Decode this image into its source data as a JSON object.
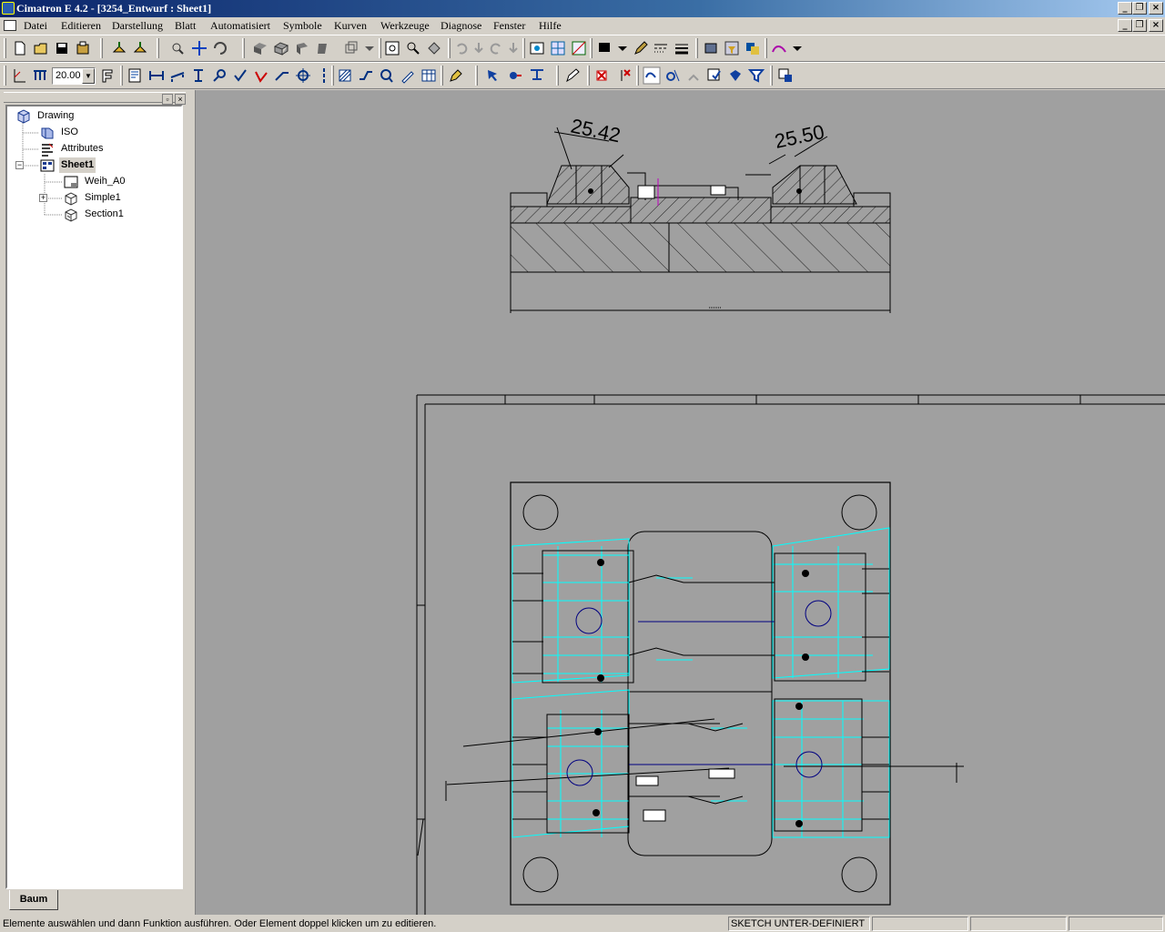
{
  "window": {
    "title": "Cimatron E 4.2 - [3254_Entwurf : Sheet1]",
    "minimize_glyph": "_",
    "restore_glyph": "❐",
    "close_glyph": "×"
  },
  "menu": {
    "items": [
      "Datei",
      "Editieren",
      "Darstellung",
      "Blatt",
      "Automatisiert",
      "Symbole",
      "Kurven",
      "Werkzeuge",
      "Diagnose",
      "Fenster",
      "Hilfe"
    ]
  },
  "toolbar2": {
    "scale_value": "20.00"
  },
  "tree": {
    "root": "Drawing",
    "iso": "ISO",
    "attributes": "Attributes",
    "sheet": "Sheet1",
    "weih": "Weih_A0",
    "simple": "Simple1",
    "section": "Section1"
  },
  "tabs": {
    "baum": "Baum"
  },
  "drawing": {
    "dim_left": "25.42",
    "dim_right": "25.50"
  },
  "status": {
    "message": "Elemente auswählen und dann Funktion ausführen. Oder Element doppel klicken um zu editieren.",
    "sketch": "SKETCH UNTER-DEFINIERT"
  },
  "colors": {
    "accent": "#00ffff",
    "selection": "#000080"
  }
}
